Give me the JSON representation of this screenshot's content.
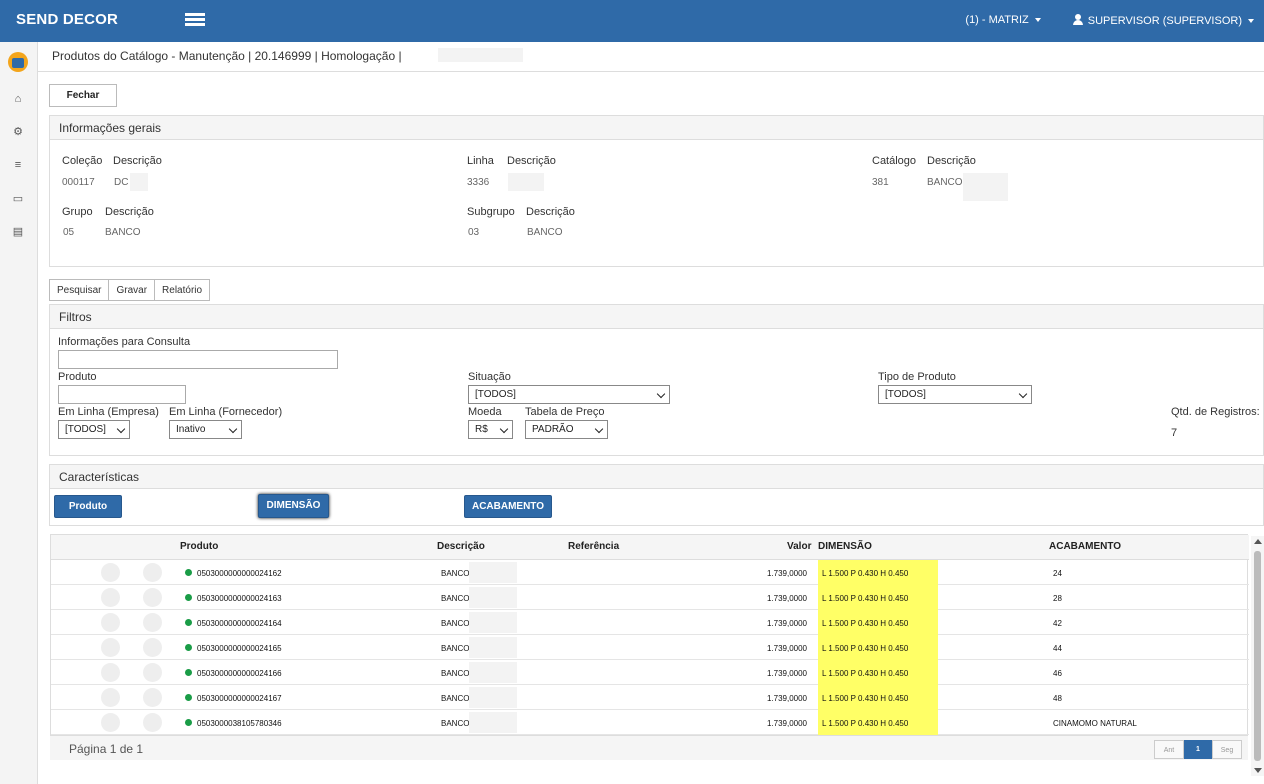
{
  "topbar": {
    "brand": "SEND DECOR",
    "branch": "(1) - MATRIZ",
    "user": "SUPERVISOR (SUPERVISOR)"
  },
  "breadcrumb": "Produtos do Catálogo - Manutenção | 20.146999 | Homologação |",
  "close_button": "Fechar",
  "general": {
    "title": "Informações gerais",
    "colecao_label": "Coleção",
    "colecao_value": "000117",
    "colecao_desc_label": "Descrição",
    "colecao_desc_value": "DC",
    "linha_label": "Linha",
    "linha_value": "3336",
    "linha_desc_label": "Descrição",
    "catalogo_label": "Catálogo",
    "catalogo_value": "381",
    "catalogo_desc_label": "Descrição",
    "catalogo_desc_value": "BANCO",
    "grupo_label": "Grupo",
    "grupo_value": "05",
    "grupo_desc_label": "Descrição",
    "grupo_desc_value": "BANCO",
    "subgrupo_label": "Subgrupo",
    "subgrupo_value": "03",
    "subgrupo_desc_label": "Descrição",
    "subgrupo_desc_value": "BANCO"
  },
  "tabs": [
    "Pesquisar",
    "Gravar",
    "Relatório"
  ],
  "filters": {
    "title": "Filtros",
    "info_label": "Informações para Consulta",
    "produto_label": "Produto",
    "situacao_label": "Situação",
    "situacao_value": "[TODOS]",
    "tipo_label": "Tipo de Produto",
    "tipo_value": "[TODOS]",
    "em_linha_emp_label": "Em Linha (Empresa)",
    "em_linha_emp_value": "[TODOS]",
    "em_linha_forn_label": "Em Linha (Fornecedor)",
    "em_linha_forn_value": "Inativo",
    "moeda_label": "Moeda",
    "moeda_value": "R$",
    "tabela_label": "Tabela de Preço",
    "tabela_value": "PADRÃO",
    "qtd_label": "Qtd. de Registros:",
    "qtd_value": "7"
  },
  "characteristics": {
    "title": "Características",
    "buttons": [
      "Produto",
      "DIMENSÃO",
      "ACABAMENTO"
    ]
  },
  "grid": {
    "columns": [
      "Produto",
      "Descrição",
      "Referência",
      "Valor",
      "DIMENSÃO",
      "ACABAMENTO"
    ],
    "rows": [
      {
        "produto": "0503000000000024162",
        "descricao": "BANCO",
        "valor": "1.739,0000",
        "dimensao": "L 1.500 P 0.430 H 0.450",
        "acabamento": "24"
      },
      {
        "produto": "0503000000000024163",
        "descricao": "BANCO",
        "valor": "1.739,0000",
        "dimensao": "L 1.500 P 0.430 H 0.450",
        "acabamento": "28"
      },
      {
        "produto": "0503000000000024164",
        "descricao": "BANCO",
        "valor": "1.739,0000",
        "dimensao": "L 1.500 P 0.430 H 0.450",
        "acabamento": "42"
      },
      {
        "produto": "0503000000000024165",
        "descricao": "BANCO",
        "valor": "1.739,0000",
        "dimensao": "L 1.500 P 0.430 H 0.450",
        "acabamento": "44"
      },
      {
        "produto": "0503000000000024166",
        "descricao": "BANCO",
        "valor": "1.739,0000",
        "dimensao": "L 1.500 P 0.430 H 0.450",
        "acabamento": "46"
      },
      {
        "produto": "0503000000000024167",
        "descricao": "BANCO",
        "valor": "1.739,0000",
        "dimensao": "L 1.500 P 0.430 H 0.450",
        "acabamento": "48"
      },
      {
        "produto": "0503000038105780346",
        "descricao": "BANCO",
        "valor": "1.739,0000",
        "dimensao": "L 1.500 P 0.430 H 0.450",
        "acabamento": "CINAMOMO NATURAL"
      }
    ]
  },
  "pager": {
    "label": "Página 1 de 1",
    "prev": "Ant",
    "current": "1",
    "next": "Seg"
  },
  "colors": {
    "brand_blue": "#2f6aa8",
    "highlight_yellow": "#ffff66",
    "status_green": "#1a9c47"
  }
}
